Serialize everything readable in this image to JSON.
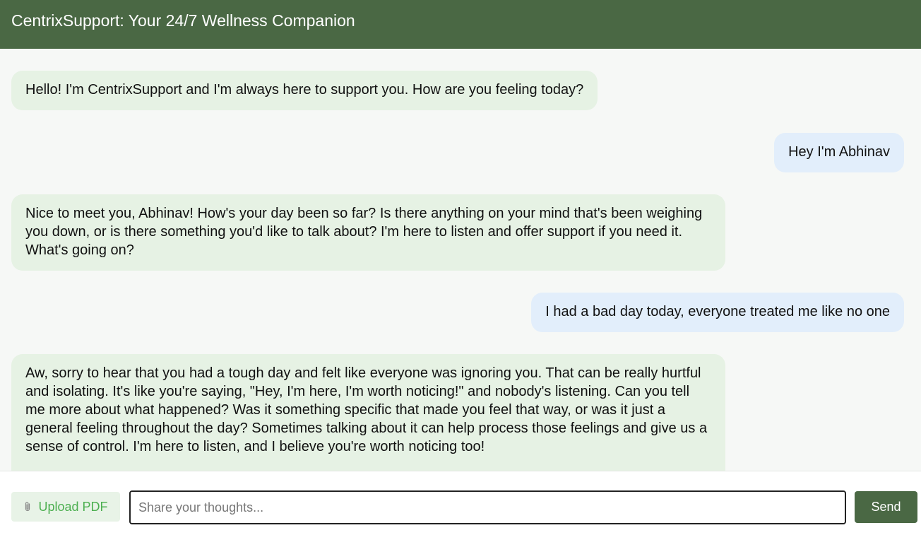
{
  "header": {
    "title": "CentrixSupport: Your 24/7 Wellness Companion"
  },
  "messages": [
    {
      "sender": "bot",
      "text": "Hello! I'm CentrixSupport and I'm always here to support you. How are you feeling today?"
    },
    {
      "sender": "user",
      "text": "Hey I'm Abhinav"
    },
    {
      "sender": "bot",
      "text": "Nice to meet you, Abhinav! How's your day been so far? Is there anything on your mind that's been weighing you down, or is there something you'd like to talk about? I'm here to listen and offer support if you need it. What's going on?"
    },
    {
      "sender": "user",
      "text": "I had a bad day today, everyone treated me like no one"
    },
    {
      "sender": "bot",
      "text": "Aw, sorry to hear that you had a tough day and felt like everyone was ignoring you. That can be really hurtful and isolating. It's like you're saying, \"Hey, I'm here, I'm worth noticing!\" and nobody's listening. Can you tell me more about what happened? Was it something specific that made you feel that way, or was it just a general feeling throughout the day? Sometimes talking about it can help process those feelings and give us a sense of control. I'm here to listen, and I believe you're worth noticing too!"
    }
  ],
  "composer": {
    "upload_label": "Upload PDF",
    "upload_icon": "paperclip-icon",
    "input_placeholder": "Share your thoughts...",
    "input_value": "",
    "send_label": "Send"
  },
  "colors": {
    "header_bg": "#4a6844",
    "bot_bubble": "#e6f2e4",
    "user_bubble": "#e2eefb",
    "upload_text": "#4caf50",
    "send_bg": "#4a6844"
  }
}
